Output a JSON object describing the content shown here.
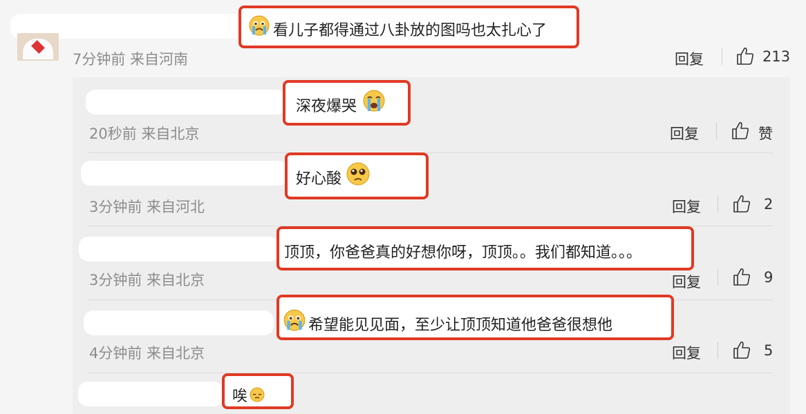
{
  "top_comment": {
    "text": "看儿子都得通过八卦放的图吗也太扎心了",
    "meta": "7分钟前 来自河南",
    "reply_label": "回复",
    "like_count": "213",
    "emoji": "crying-face"
  },
  "replies": [
    {
      "text": "深夜爆哭",
      "meta": "20秒前 来自北京",
      "reply_label": "回复",
      "like_label": "赞",
      "emoji": "loudly-crying-face"
    },
    {
      "text": "好心酸",
      "meta": "3分钟前 来自河北",
      "reply_label": "回复",
      "like_label": "2",
      "emoji": "pleading-face"
    },
    {
      "text": "顶顶，你爸爸真的好想你呀，顶顶。。我们都知道。。。",
      "meta": "3分钟前 来自北京",
      "reply_label": "回复",
      "like_label": "9"
    },
    {
      "text": "希望能见见面，至少让顶顶知道他爸爸很想他",
      "meta": "4分钟前 来自北京",
      "reply_label": "回复",
      "like_label": "5",
      "emoji": "crying-face"
    },
    {
      "text": "唉",
      "emoji": "pensive-face"
    }
  ],
  "colors": {
    "highlight": "#e03a24",
    "panel": "#eeeeee",
    "meta": "#8c8c8c"
  }
}
